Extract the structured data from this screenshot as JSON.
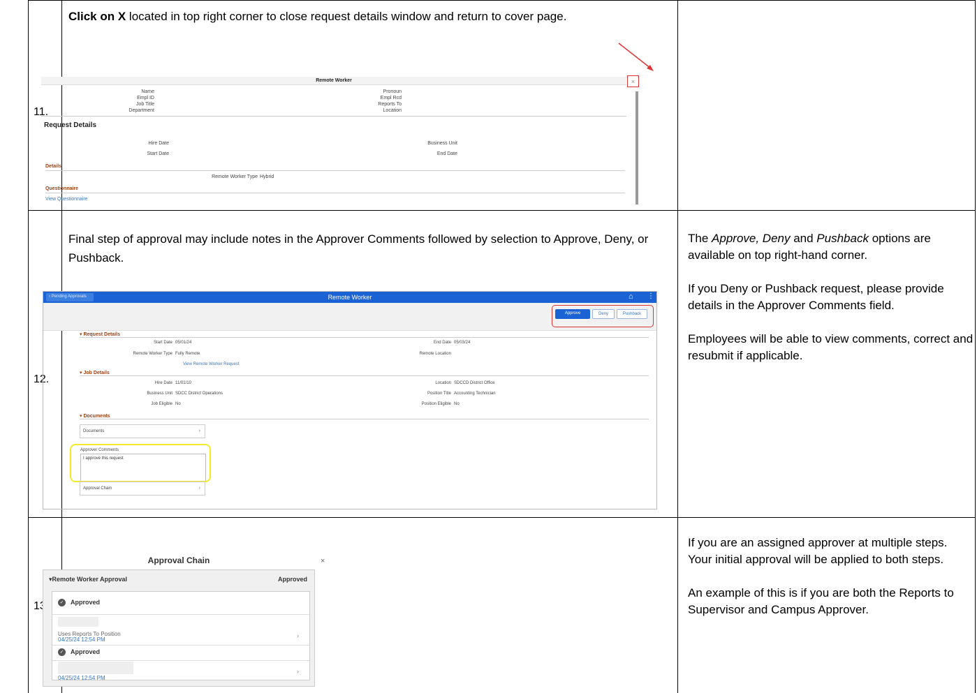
{
  "rows": [
    {
      "number": "11.",
      "instruction_bold": "Click on X",
      "instruction_rest": " located in top right corner to close request details window and return to cover page.",
      "note": []
    },
    {
      "number": "12.",
      "instruction": "Final step of approval may include notes in the Approver Comments followed by selection to Approve, Deny, or Pushback.",
      "note_intro_italic": "Approve, Deny",
      "note_intro_and": " and ",
      "note_intro_italic2": "Pushback",
      "note_intro_prefix": "The ",
      "note_intro_suffix": " options are available on top right-hand corner.",
      "note_p2": "If you Deny or Pushback request, please provide details in the Approver Comments field.",
      "note_p3": "Employees will be able to view comments, correct and resubmit if applicable."
    },
    {
      "number": "13.",
      "note_p1": "If you are an assigned approver at multiple steps.  Your initial approval will be applied to both steps.",
      "note_p2": "An example of this is if you are both the Reports to Supervisor and Campus Approver."
    }
  ],
  "shot11": {
    "title": "Remote Worker",
    "close": "×",
    "left_fields": [
      "Name",
      "Empl ID",
      "Job Title",
      "Department"
    ],
    "right_fields": [
      "Pronoun",
      "Empl Rcd",
      "Reports To",
      "Location"
    ],
    "request_details": "Request Details",
    "hire_date": "Hire Date",
    "start_date": "Start Date",
    "business_unit": "Business Unit",
    "end_date": "End Date",
    "details": "Details",
    "worker_type_label": "Remote Worker Type",
    "worker_type_value": "Hybrid",
    "questionnaire": "Questionnaire",
    "view_questionnaire": "View Questionnaire"
  },
  "shot12": {
    "back": "‹  Pending Approvals",
    "title": "Remote Worker",
    "approve": "Approve",
    "deny": "Deny",
    "pushback": "Pushback",
    "request_details": "▾ Request Details",
    "start_date_label": "Start Date",
    "start_date": "05/01/24",
    "end_date_label": "End Date",
    "end_date": "05/03/24",
    "worker_type_label": "Remote Worker Type",
    "worker_type": "Fully Remote",
    "remote_location_label": "Remote Location",
    "view_request": "View Remote Worker Request",
    "job_details": "▾ Job Details",
    "hire_date_label": "Hire Date",
    "hire_date": "11/01/10",
    "location_label": "Location",
    "location": "SDCCD District Office",
    "business_unit_label": "Business Unit",
    "business_unit": "SDCC District Operations",
    "position_title_label": "Position Title",
    "position_title": "Accounting Technician",
    "job_eligible_label": "Job Eligible",
    "job_eligible": "No",
    "position_eligible_label": "Position Eligible",
    "position_eligible": "No",
    "documents_section": "▾ Documents",
    "documents_link": "Documents",
    "comments_label": "Approver Comments",
    "comments_value": "I approve this request",
    "approval_chain": "Approval Chain"
  },
  "shot13": {
    "title": "Approval Chain",
    "close": "×",
    "section": "▾Remote Worker Approval",
    "section_status": "Approved",
    "step1_status": "Approved",
    "step1_text": "Uses Reports To Position",
    "step1_time": "04/25/24 12:54 PM",
    "step2_status": "Approved",
    "step2_time": "04/25/24 12:54 PM"
  }
}
